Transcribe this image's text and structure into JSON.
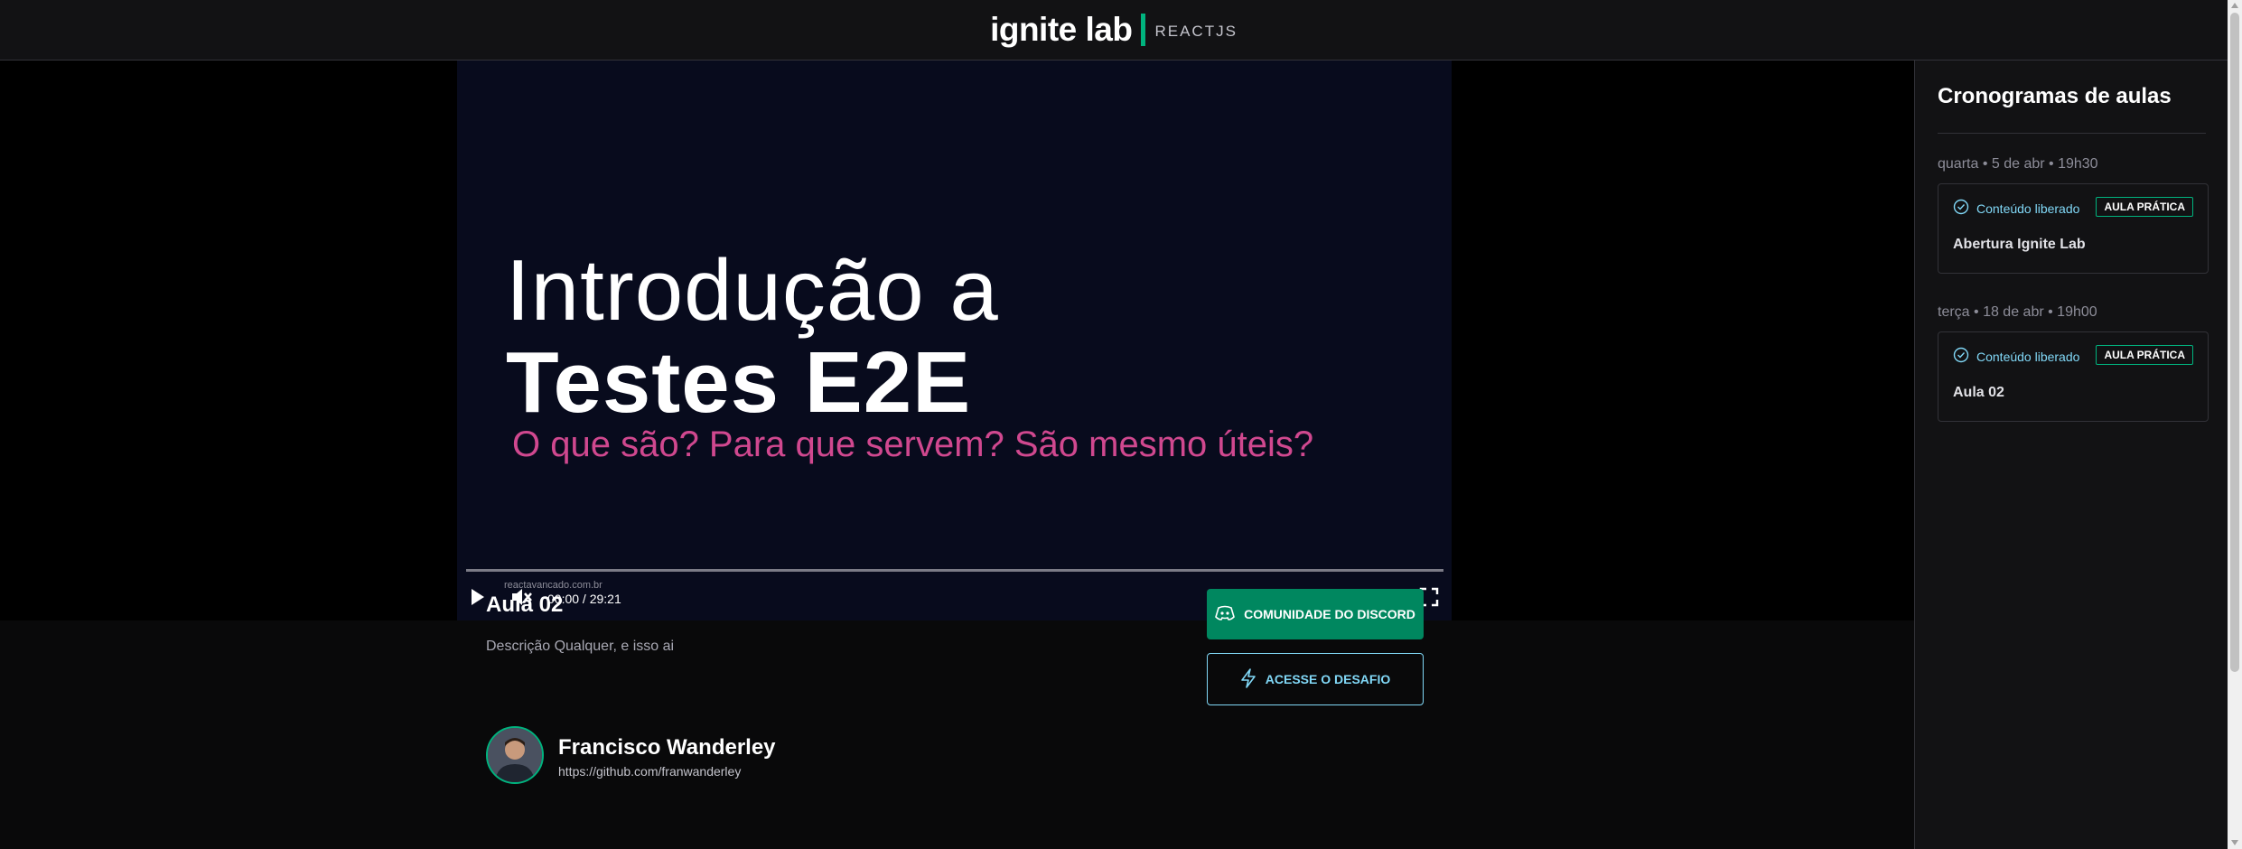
{
  "header": {
    "logo_main": "ignite lab",
    "logo_sub": "REACTJS"
  },
  "video": {
    "title_line1": "Introdução a",
    "title_line2": "Testes E2E",
    "subtitle": "O que são? Para que servem? São mesmo úteis?",
    "watermark": "reactavancado.com.br",
    "time": "00:00 / 29:21",
    "progress": 0
  },
  "lesson": {
    "title": "Aula 02",
    "description": "Descrição Qualquer, e isso ai",
    "discord_button": "COMUNIDADE DO DISCORD",
    "challenge_button": "ACESSE O DESAFIO"
  },
  "author": {
    "name": "Francisco Wanderley",
    "link": "https://github.com/franwanderley"
  },
  "sidebar": {
    "title": "Cronogramas de aulas",
    "lessons": [
      {
        "date": "quarta • 5 de abr • 19h30",
        "status": "Conteúdo liberado",
        "badge": "AULA PRÁTICA",
        "title": "Abertura Ignite Lab"
      },
      {
        "date": "terça • 18 de abr • 19h00",
        "status": "Conteúdo liberado",
        "badge": "AULA PRÁTICA",
        "title": "Aula 02"
      }
    ]
  },
  "colors": {
    "accent_green": "#00b37e",
    "button_green": "#00875f",
    "accent_blue": "#81d8f7",
    "video_subtitle": "#d0488f"
  }
}
